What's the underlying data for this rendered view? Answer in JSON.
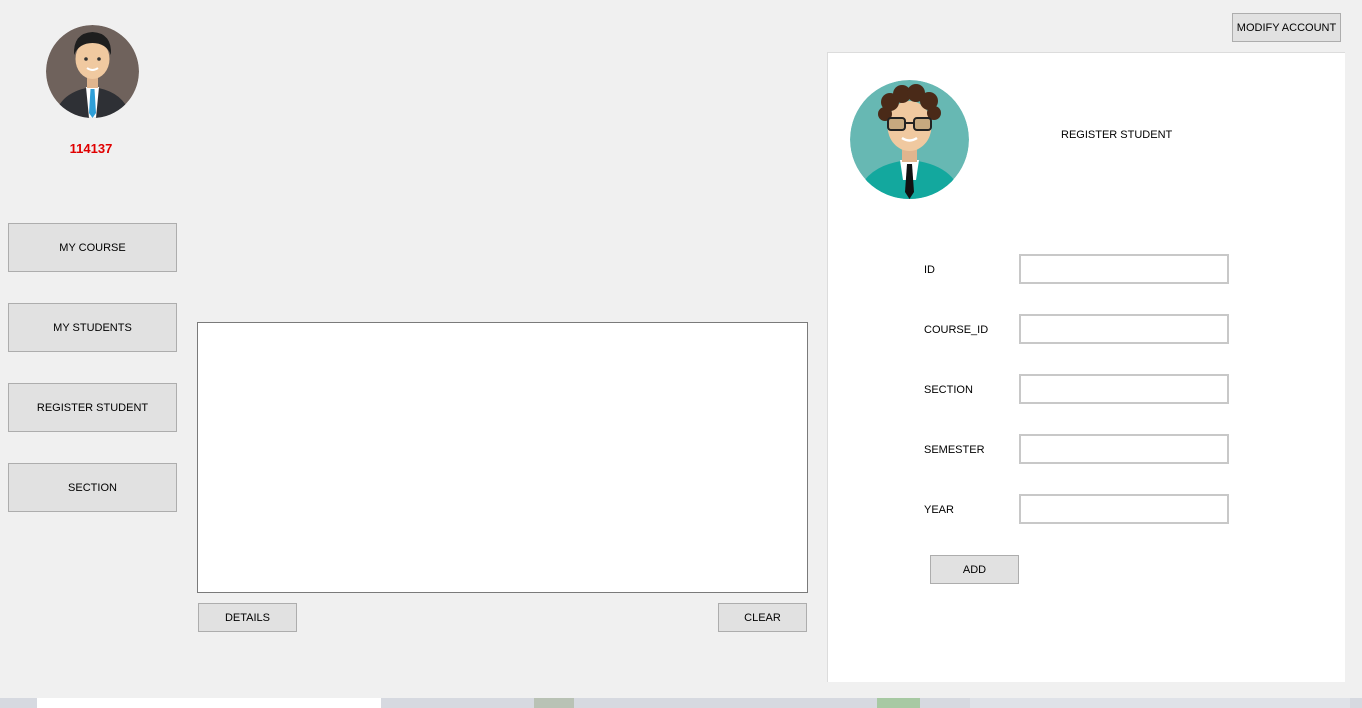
{
  "user": {
    "id_label": "114137"
  },
  "nav": {
    "my_course": "MY COURSE",
    "my_students": "MY STUDENTS",
    "register_student": "REGISTER STUDENT",
    "section": "SECTION"
  },
  "center": {
    "details_button": "DETAILS",
    "clear_button": "CLEAR"
  },
  "header": {
    "modify_account_button": "MODIFY ACCOUNT"
  },
  "form": {
    "title": "REGISTER STUDENT",
    "fields": [
      {
        "label": "ID",
        "value": ""
      },
      {
        "label": "COURSE_ID",
        "value": ""
      },
      {
        "label": "SECTION",
        "value": ""
      },
      {
        "label": "SEMESTER",
        "value": ""
      },
      {
        "label": "YEAR",
        "value": ""
      }
    ],
    "add_button": "ADD"
  },
  "colors": {
    "accent_red": "#e00000",
    "button_bg": "#e1e1e1",
    "window_bg": "#f0f0f0"
  }
}
